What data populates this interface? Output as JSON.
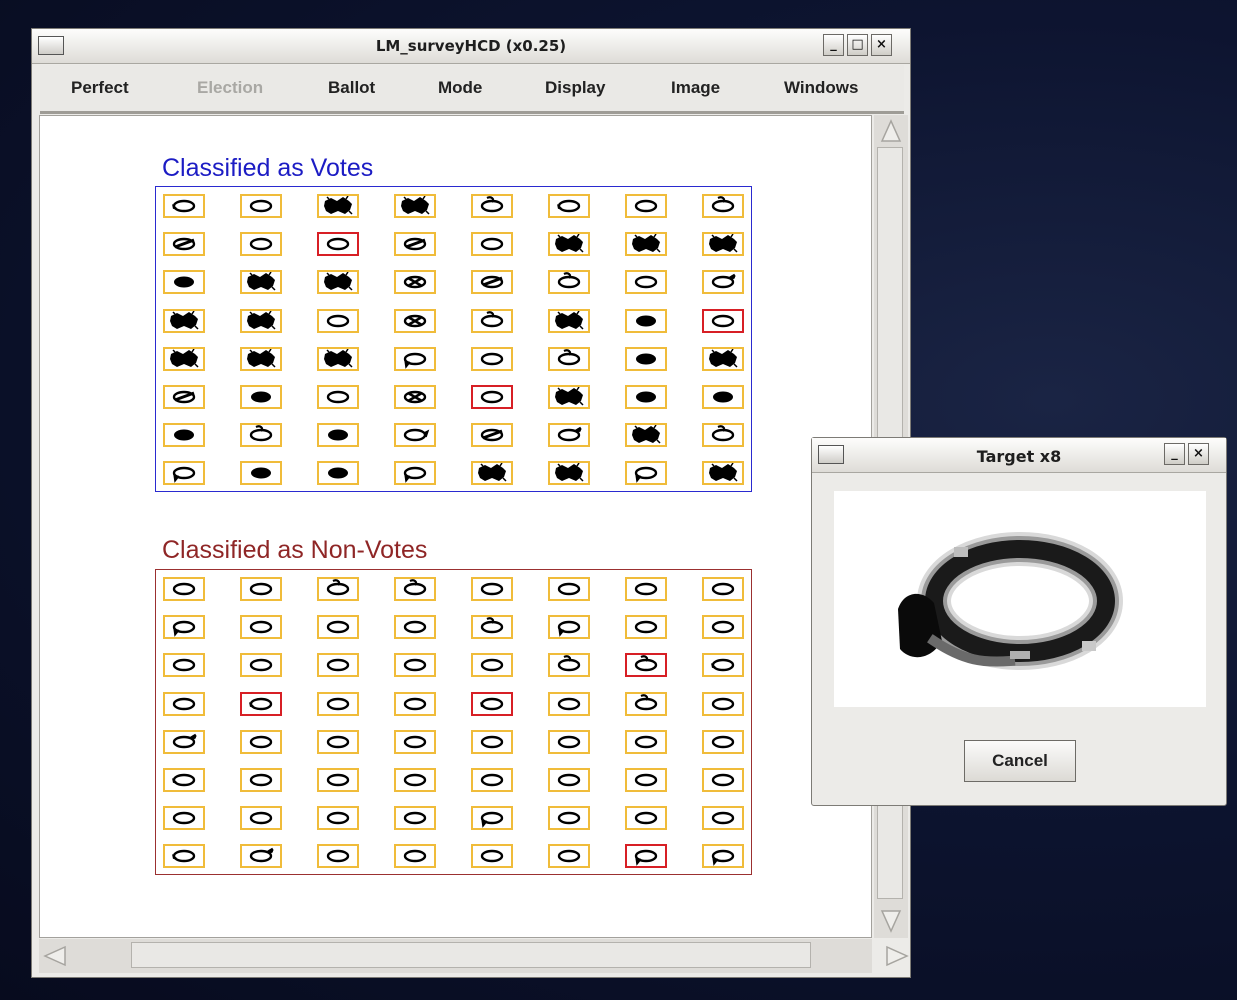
{
  "main_window": {
    "title": "LM_surveyHCD (x0.25)",
    "controls": {
      "minimize": "_",
      "maximize": "□",
      "close": "×"
    },
    "menu": [
      {
        "label": "Perfect",
        "enabled": true
      },
      {
        "label": "Election",
        "enabled": false
      },
      {
        "label": "Ballot",
        "enabled": true
      },
      {
        "label": "Mode",
        "enabled": true
      },
      {
        "label": "Display",
        "enabled": true
      },
      {
        "label": "Image",
        "enabled": true
      },
      {
        "label": "Windows",
        "enabled": true
      }
    ]
  },
  "votes_section": {
    "title": "Classified as Votes",
    "title_color": "#1c1cc4",
    "frame_color": "#2a2ad0",
    "columns": 8,
    "cells": [
      "plain-tail",
      "plain",
      "heavy",
      "heavy",
      "loop-top",
      "plain-tail",
      "plain",
      "loop-top",
      "slash",
      "plain",
      "plain",
      "slash",
      "plain",
      "heavy",
      "heavy",
      "heavy",
      "filled",
      "heavy",
      "heavy",
      "cross",
      "slash",
      "loop-top",
      "plain",
      "tick",
      "heavy",
      "heavy",
      "plain",
      "cross",
      "loop-top",
      "heavy",
      "filled",
      "plain",
      "heavy",
      "heavy",
      "heavy",
      "tail-left",
      "plain",
      "loop-top",
      "filled",
      "heavy",
      "slash",
      "filled",
      "plain",
      "cross",
      "plain",
      "heavy",
      "filled",
      "filled",
      "filled",
      "loop-top",
      "filled",
      "tail-right",
      "slash",
      "tick",
      "heavy",
      "loop-top",
      "tail-left",
      "filled",
      "filled",
      "tail-left",
      "heavy",
      "heavy",
      "tail-left",
      "heavy"
    ],
    "flagged": [
      10,
      31,
      44
    ]
  },
  "nonvotes_section": {
    "title": "Classified as Non-Votes",
    "title_color": "#8f2626",
    "frame_color": "#9b3030",
    "columns": 8,
    "cells": [
      "plain",
      "plain",
      "loop-top",
      "loop-top",
      "plain",
      "plain",
      "plain",
      "plain",
      "tail-left",
      "plain",
      "plain",
      "plain",
      "loop-top",
      "tail-left",
      "plain",
      "plain",
      "plain",
      "plain",
      "plain",
      "plain",
      "plain",
      "loop-top",
      "loop-top",
      "plain-tail",
      "plain",
      "plain-tail",
      "plain",
      "plain",
      "plain-tail",
      "plain",
      "loop-top",
      "plain",
      "tick",
      "plain",
      "plain",
      "plain",
      "plain",
      "plain",
      "plain",
      "plain",
      "plain-tail",
      "plain",
      "plain",
      "plain",
      "plain",
      "plain",
      "plain",
      "plain",
      "plain",
      "plain",
      "plain",
      "plain",
      "tail-left",
      "plain",
      "plain",
      "plain",
      "plain-tail",
      "tick",
      "plain",
      "plain",
      "plain",
      "plain",
      "tail-left",
      "tail-left"
    ],
    "flagged": [
      22,
      25,
      28,
      62
    ]
  },
  "target_dialog": {
    "title": "Target x8",
    "controls": {
      "minimize": "_",
      "close": "×"
    },
    "cancel_label": "Cancel",
    "preview_icon": "magnified-ballot-mark"
  }
}
